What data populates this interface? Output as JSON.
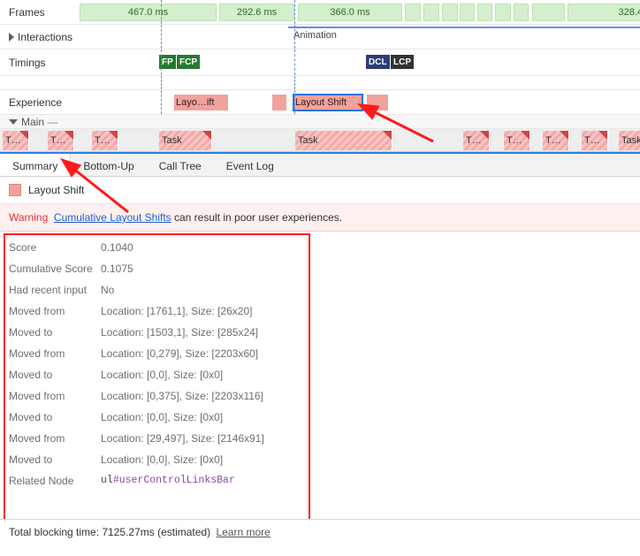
{
  "lanes": {
    "frames": {
      "label": "Frames",
      "blocks": [
        "467.0 ms",
        "292.6 ms",
        "366.0 ms",
        "328.4"
      ]
    },
    "interactions": {
      "label": "Interactions",
      "animation_label": "Animation"
    },
    "timings": {
      "label": "Timings",
      "badges": [
        "FP",
        "FCP",
        "DCL",
        "LCP"
      ]
    },
    "experience": {
      "label": "Experience",
      "blocks": [
        "Layo…ift",
        "Layout Shift"
      ]
    },
    "main": {
      "label": "Main",
      "task_label": "Task",
      "short_task": "T…"
    }
  },
  "tabs": [
    "Summary",
    "Bottom-Up",
    "Call Tree",
    "Event Log"
  ],
  "event": {
    "title": "Layout Shift",
    "warning_prefix": "Warning",
    "warning_link": "Cumulative Layout Shifts",
    "warning_suffix": " can result in poor user experiences.",
    "rows": [
      {
        "k": "Score",
        "v": "0.1040"
      },
      {
        "k": "Cumulative Score",
        "v": "0.1075"
      },
      {
        "k": "Had recent input",
        "v": "No"
      },
      {
        "k": "Moved from",
        "v": "Location: [1761,1], Size: [26x20]"
      },
      {
        "k": "Moved to",
        "v": "Location: [1503,1], Size: [285x24]"
      },
      {
        "k": "Moved from",
        "v": "Location: [0,279], Size: [2203x60]"
      },
      {
        "k": "Moved to",
        "v": "Location: [0,0], Size: [0x0]"
      },
      {
        "k": "Moved from",
        "v": "Location: [0,375], Size: [2203x116]"
      },
      {
        "k": "Moved to",
        "v": "Location: [0,0], Size: [0x0]"
      },
      {
        "k": "Moved from",
        "v": "Location: [29,497], Size: [2146x91]"
      },
      {
        "k": "Moved to",
        "v": "Location: [0,0], Size: [0x0]"
      }
    ],
    "related_label": "Related Node",
    "related_node_tag": "ul",
    "related_node_id": "#userControlLinksBar"
  },
  "footer": {
    "text": "Total blocking time: 7125.27ms (estimated)",
    "learn_more": "Learn more"
  }
}
